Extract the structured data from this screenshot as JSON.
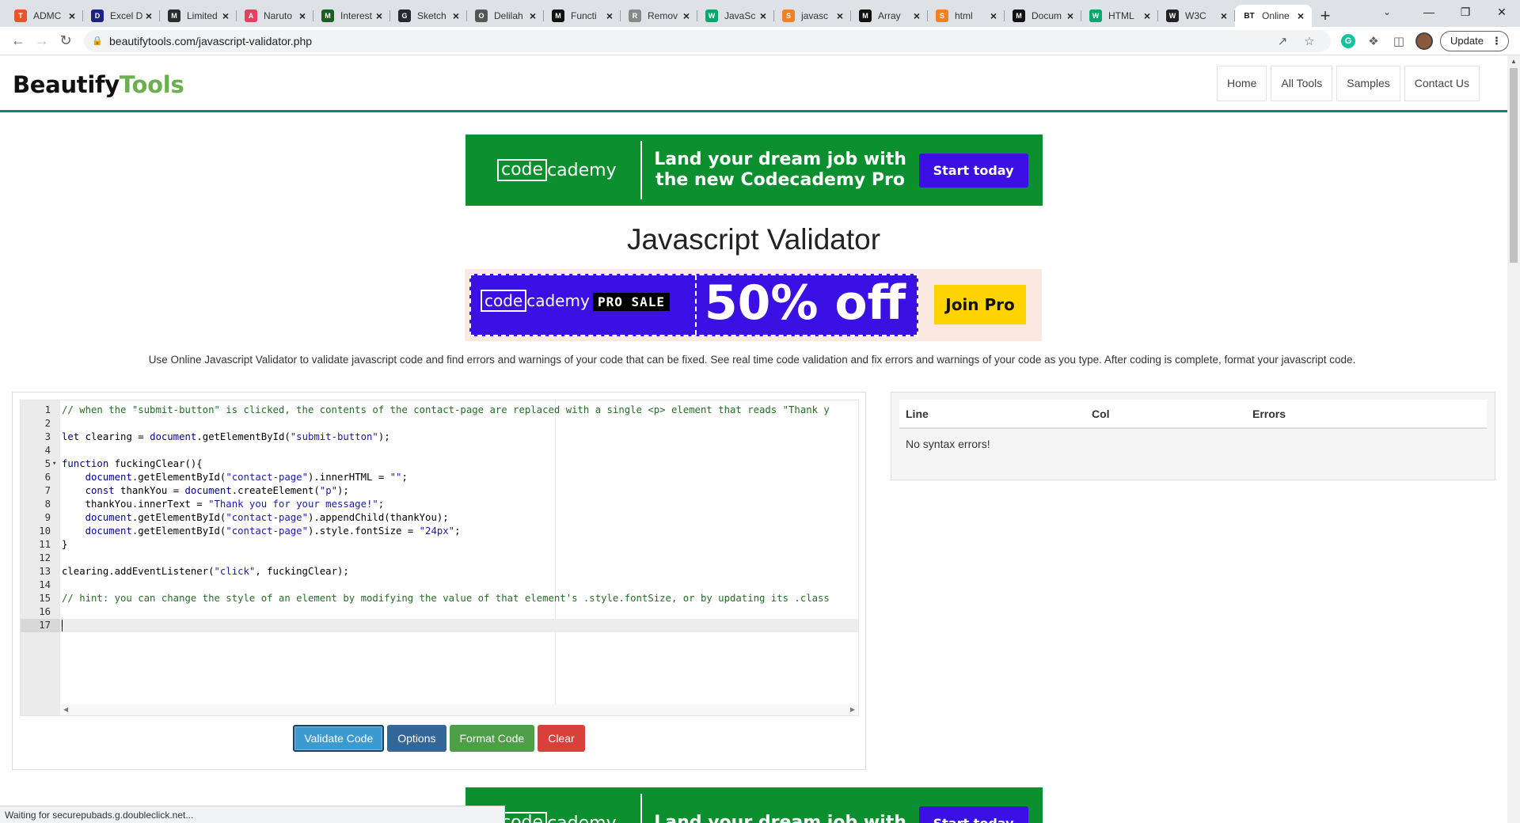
{
  "browser": {
    "tabs": [
      {
        "title": "ADMC",
        "favicon": "T",
        "color": "#e8542b"
      },
      {
        "title": "Excel Dri",
        "favicon": "D",
        "color": "#1a237e"
      },
      {
        "title": "Limited",
        "favicon": "M",
        "color": "#2b2b2b"
      },
      {
        "title": "Naruto",
        "favicon": "A",
        "color": "#e4405f"
      },
      {
        "title": "Interest",
        "favicon": "M",
        "color": "#1b5e20"
      },
      {
        "title": "Sketch",
        "favicon": "G",
        "color": "#24292e"
      },
      {
        "title": "Delilah",
        "favicon": "O",
        "color": "#555555"
      },
      {
        "title": "Functi",
        "favicon": "M",
        "color": "#111111"
      },
      {
        "title": "Remov",
        "favicon": "R",
        "color": "#888888"
      },
      {
        "title": "JavaSc",
        "favicon": "W",
        "color": "#04aa6d"
      },
      {
        "title": "javasc",
        "favicon": "S",
        "color": "#f48024"
      },
      {
        "title": "Array",
        "favicon": "M",
        "color": "#111111"
      },
      {
        "title": "html",
        "favicon": "S",
        "color": "#f48024"
      },
      {
        "title": "Docum",
        "favicon": "M",
        "color": "#111111"
      },
      {
        "title": "HTML",
        "favicon": "W",
        "color": "#04aa6d"
      },
      {
        "title": "W3C",
        "favicon": "W",
        "color": "#222222"
      },
      {
        "title": "Online",
        "favicon": "BT",
        "color": "#ffffff",
        "active": true
      }
    ],
    "url": "beautifytools.com/javascript-validator.php",
    "update_label": "Update"
  },
  "site": {
    "logo_part1": "Beautify",
    "logo_part2": "Tools",
    "nav": [
      "Home",
      "All Tools",
      "Samples",
      "Contact Us"
    ]
  },
  "ad_top": {
    "brand_boxed": "code",
    "brand_rest": "cademy",
    "message": "Land your dream job with the new Codecademy Pro",
    "button": "Start today"
  },
  "page_title": "Javascript Validator",
  "ad_middle": {
    "brand_boxed": "code",
    "brand_rest": "cademy",
    "badge": "PRO SALE",
    "offer": "50% off",
    "button": "Join Pro"
  },
  "description": "Use Online Javascript Validator to validate javascript code and find errors and warnings of your code that can be fixed. See real time code validation and fix errors and warnings of your code as you type. After coding is complete, format your javascript code.",
  "editor": {
    "lines": [
      "// when the \"submit-button\" is clicked, the contents of the contact-page are replaced with a single <p> element that reads \"Thank y",
      "",
      "let clearing = document.getElementById(\"submit-button\");",
      "",
      "function fuckingClear(){",
      "    document.getElementById(\"contact-page\").innerHTML = \"\";",
      "    const thankYou = document.createElement(\"p\");",
      "    thankYou.innerText = \"Thank you for your message!\";",
      "    document.getElementById(\"contact-page\").appendChild(thankYou);",
      "    document.getElementById(\"contact-page\").style.fontSize = \"24px\";",
      "}",
      "",
      "clearing.addEventListener(\"click\", fuckingClear);",
      "",
      "// hint: you can change the style of an element by modifying the value of that element's .style.fontSize, or by updating its .class",
      "",
      ""
    ],
    "active_line": 17,
    "fold_line": 5
  },
  "buttons": {
    "validate": "Validate Code",
    "options": "Options",
    "format": "Format Code",
    "clear": "Clear"
  },
  "results": {
    "headers": [
      "Line",
      "Col",
      "Errors"
    ],
    "message": "No syntax errors!"
  },
  "ad_bottom": {
    "brand_boxed": "code",
    "brand_rest": "cademy",
    "message": "Land your dream job with",
    "button": "Start today"
  },
  "status": "Waiting for securepubads.g.doubleclick.net..."
}
